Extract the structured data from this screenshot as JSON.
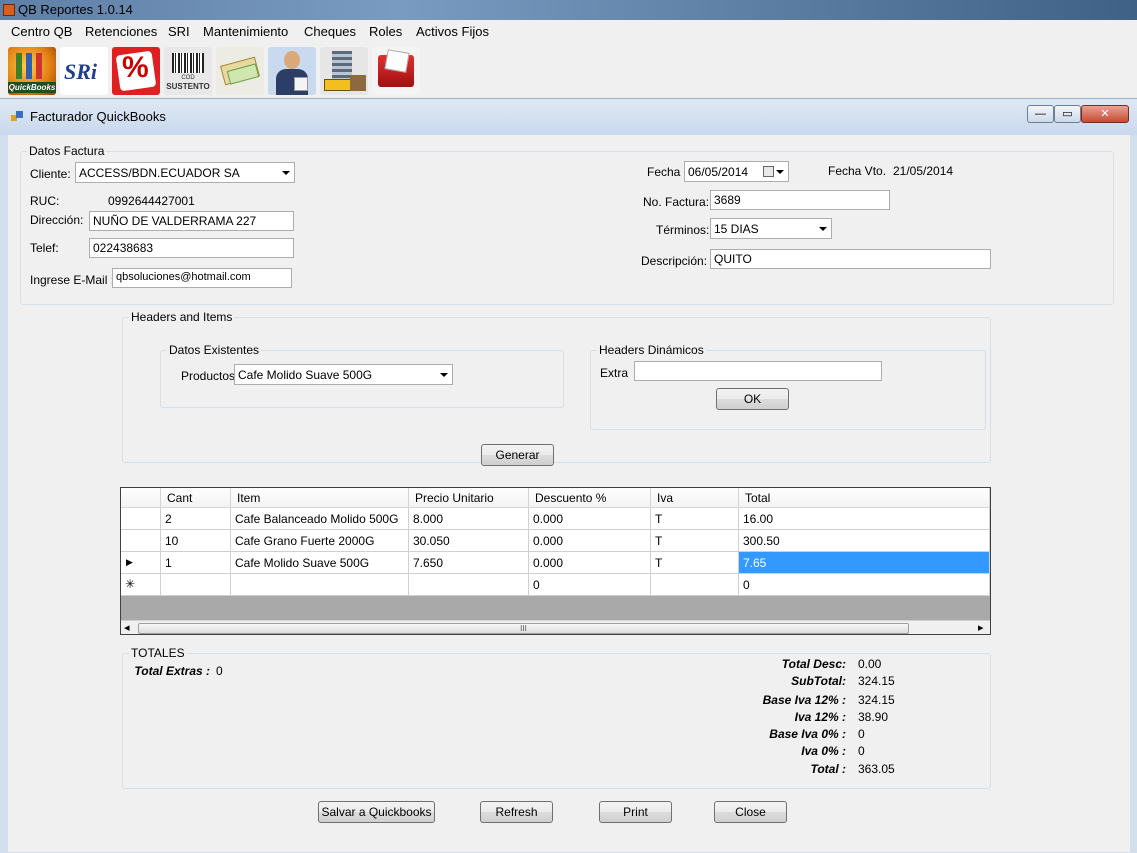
{
  "app": {
    "title": "QB Reportes 1.0.14"
  },
  "menu": [
    "Centro QB",
    "Retenciones",
    "SRI",
    "Mantenimiento",
    "Cheques",
    "Roles",
    "Activos Fijos"
  ],
  "toolbar": {
    "quickbooks_label": "QuickBooks",
    "sri_label": "SRi",
    "percent_label": "%",
    "sustento_label_top": "COD",
    "sustento_label": "SUSTENTO"
  },
  "window": {
    "title": "Facturador QuickBooks",
    "min": "—",
    "max": "▭",
    "close": "✕"
  },
  "datos_factura": {
    "legend": "Datos Factura",
    "cliente_label": "Cliente:",
    "cliente_value": "ACCESS/BDN.ECUADOR SA",
    "ruc_label": "RUC:",
    "ruc_value": "0992644427001",
    "direccion_label": "Dirección:",
    "direccion_value": "NUÑO DE VALDERRAMA 227",
    "telef_label": "Telef:",
    "telef_value": "022438683",
    "email_label": "Ingrese E-Mail :",
    "email_value": "qbsoluciones@hotmail.com",
    "fecha_label": "Fecha",
    "fecha_value": "06/05/2014",
    "fecha_vto_label": "Fecha Vto.",
    "fecha_vto_value": "21/05/2014",
    "no_factura_label": "No. Factura:",
    "no_factura_value": "3689",
    "terminos_label": "Términos:",
    "terminos_value": "15 DIAS",
    "descripcion_label": "Descripción:",
    "descripcion_value": "QUITO"
  },
  "headers_items": {
    "legend": "Headers and Items",
    "existentes_legend": "Datos Existentes",
    "productos_label": "Productos",
    "productos_value": "Cafe Molido Suave 500G",
    "dinamicos_legend": "Headers Dinámicos",
    "extra_label": "Extra",
    "extra_value": "",
    "ok_label": "OK",
    "generar_label": "Generar"
  },
  "grid": {
    "columns": [
      "Cant",
      "Item",
      "Precio Unitario",
      "Descuento %",
      "Iva",
      "Total"
    ],
    "rows": [
      [
        "2",
        "Cafe Balanceado Molido 500G",
        "8.000",
        "0.000",
        "T",
        "16.00"
      ],
      [
        "10",
        "Cafe Grano Fuerte 2000G",
        "30.050",
        "0.000",
        "T",
        "300.50"
      ],
      [
        "1",
        "Cafe Molido Suave 500G",
        "7.650",
        "0.000",
        "T",
        "7.65"
      ]
    ],
    "new_row": [
      "",
      "",
      "",
      "0",
      "",
      "0"
    ],
    "current_marker": "▶",
    "new_marker": "✳",
    "scroll_left": "◂",
    "scroll_right": "▸",
    "scroll_grip": "III"
  },
  "totales": {
    "legend": "TOTALES",
    "total_extras_label": "Total Extras :",
    "total_extras_value": "0",
    "items": [
      {
        "label": "Total Desc:",
        "value": "0.00"
      },
      {
        "label": "SubTotal:",
        "value": "324.15"
      },
      {
        "label": "Base Iva 12% :",
        "value": "324.15"
      },
      {
        "label": "Iva 12% :",
        "value": "38.90"
      },
      {
        "label": "Base Iva 0% :",
        "value": "0"
      },
      {
        "label": "Iva 0% :",
        "value": "0"
      },
      {
        "label": "Total :",
        "value": "363.05"
      }
    ]
  },
  "actions": {
    "salvar": "Salvar a Quickbooks",
    "refresh": "Refresh",
    "print": "Print",
    "close": "Close"
  }
}
